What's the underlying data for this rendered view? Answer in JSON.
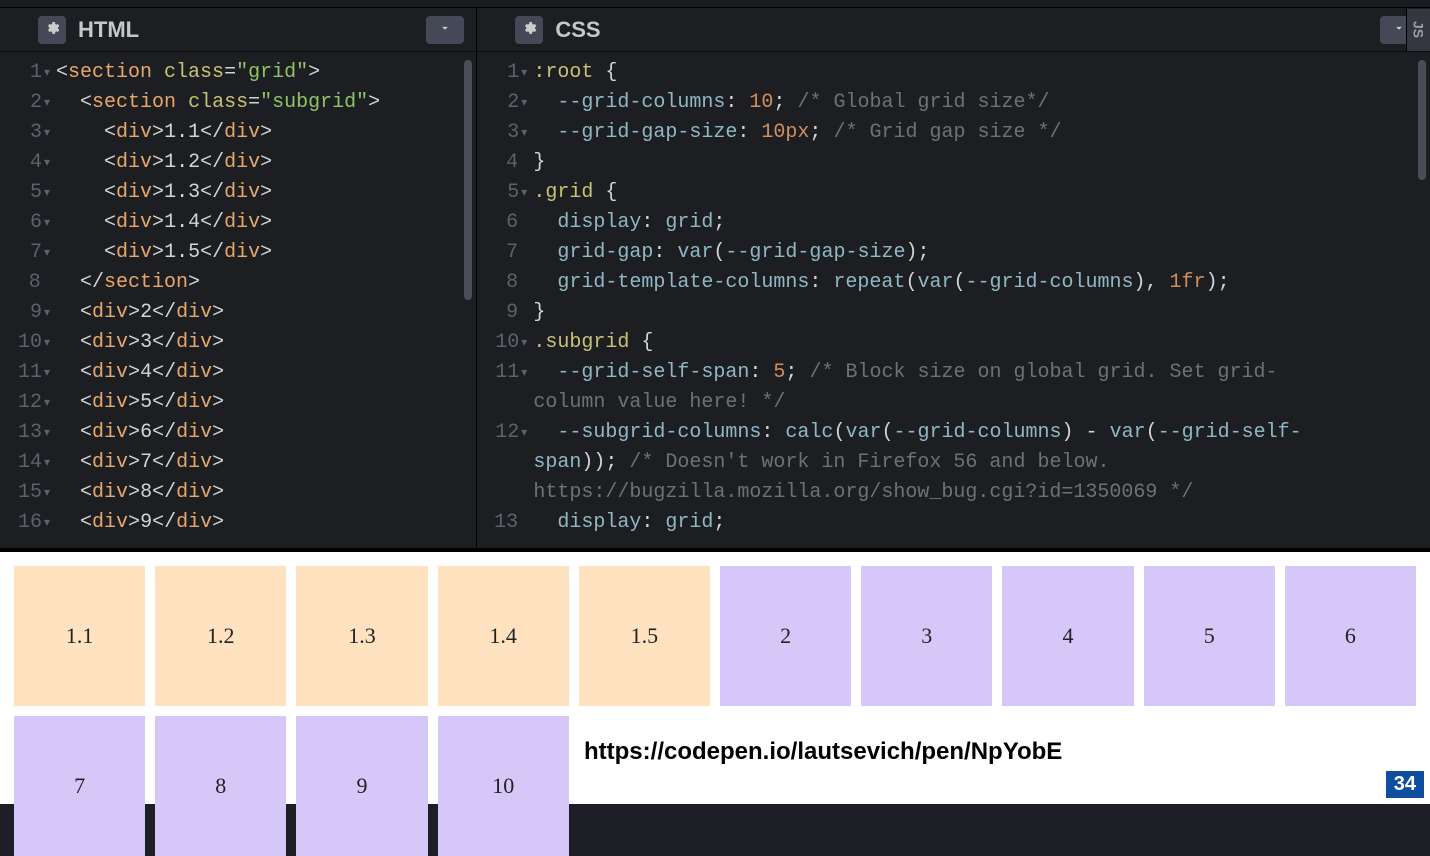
{
  "panes": {
    "html": {
      "title": "HTML"
    },
    "css": {
      "title": "CSS"
    },
    "js": {
      "title": "JS"
    }
  },
  "html_lines": [
    {
      "n": "1",
      "fold": true,
      "html": "<span class='ang'>&lt;</span><span class='tag'>section</span> <span class='attr-name'>class</span><span class='punct'>=</span><span class='str'>\"grid\"</span><span class='ang'>&gt;</span>"
    },
    {
      "n": "2",
      "fold": true,
      "html": "  <span class='ang'>&lt;</span><span class='tag'>section</span> <span class='attr-name'>class</span><span class='punct'>=</span><span class='str'>\"subgrid\"</span><span class='ang'>&gt;</span>"
    },
    {
      "n": "3",
      "fold": true,
      "html": "    <span class='ang'>&lt;</span><span class='tag'>div</span><span class='ang'>&gt;</span>1.1<span class='ang'>&lt;/</span><span class='tag'>div</span><span class='ang'>&gt;</span>"
    },
    {
      "n": "4",
      "fold": true,
      "html": "    <span class='ang'>&lt;</span><span class='tag'>div</span><span class='ang'>&gt;</span>1.2<span class='ang'>&lt;/</span><span class='tag'>div</span><span class='ang'>&gt;</span>"
    },
    {
      "n": "5",
      "fold": true,
      "html": "    <span class='ang'>&lt;</span><span class='tag'>div</span><span class='ang'>&gt;</span>1.3<span class='ang'>&lt;/</span><span class='tag'>div</span><span class='ang'>&gt;</span>"
    },
    {
      "n": "6",
      "fold": true,
      "html": "    <span class='ang'>&lt;</span><span class='tag'>div</span><span class='ang'>&gt;</span>1.4<span class='ang'>&lt;/</span><span class='tag'>div</span><span class='ang'>&gt;</span>"
    },
    {
      "n": "7",
      "fold": true,
      "html": "    <span class='ang'>&lt;</span><span class='tag'>div</span><span class='ang'>&gt;</span>1.5<span class='ang'>&lt;/</span><span class='tag'>div</span><span class='ang'>&gt;</span>"
    },
    {
      "n": "8",
      "fold": false,
      "html": "  <span class='ang'>&lt;/</span><span class='tag'>section</span><span class='ang'>&gt;</span>"
    },
    {
      "n": "9",
      "fold": true,
      "html": "  <span class='ang'>&lt;</span><span class='tag'>div</span><span class='ang'>&gt;</span>2<span class='ang'>&lt;/</span><span class='tag'>div</span><span class='ang'>&gt;</span>"
    },
    {
      "n": "10",
      "fold": true,
      "html": "  <span class='ang'>&lt;</span><span class='tag'>div</span><span class='ang'>&gt;</span>3<span class='ang'>&lt;/</span><span class='tag'>div</span><span class='ang'>&gt;</span>"
    },
    {
      "n": "11",
      "fold": true,
      "html": "  <span class='ang'>&lt;</span><span class='tag'>div</span><span class='ang'>&gt;</span>4<span class='ang'>&lt;/</span><span class='tag'>div</span><span class='ang'>&gt;</span>"
    },
    {
      "n": "12",
      "fold": true,
      "html": "  <span class='ang'>&lt;</span><span class='tag'>div</span><span class='ang'>&gt;</span>5<span class='ang'>&lt;/</span><span class='tag'>div</span><span class='ang'>&gt;</span>"
    },
    {
      "n": "13",
      "fold": true,
      "html": "  <span class='ang'>&lt;</span><span class='tag'>div</span><span class='ang'>&gt;</span>6<span class='ang'>&lt;/</span><span class='tag'>div</span><span class='ang'>&gt;</span>"
    },
    {
      "n": "14",
      "fold": true,
      "html": "  <span class='ang'>&lt;</span><span class='tag'>div</span><span class='ang'>&gt;</span>7<span class='ang'>&lt;/</span><span class='tag'>div</span><span class='ang'>&gt;</span>"
    },
    {
      "n": "15",
      "fold": true,
      "html": "  <span class='ang'>&lt;</span><span class='tag'>div</span><span class='ang'>&gt;</span>8<span class='ang'>&lt;/</span><span class='tag'>div</span><span class='ang'>&gt;</span>"
    },
    {
      "n": "16",
      "fold": true,
      "html": "  <span class='ang'>&lt;</span><span class='tag'>div</span><span class='ang'>&gt;</span>9<span class='ang'>&lt;/</span><span class='tag'>div</span><span class='ang'>&gt;</span>"
    }
  ],
  "css_lines": [
    {
      "n": "1",
      "fold": true,
      "html": "<span class='sel'>:root</span> <span class='punct'>{</span>"
    },
    {
      "n": "2",
      "fold": true,
      "html": "  <span class='prop'>--grid-columns</span><span class='punct'>:</span> <span class='num'>10</span><span class='punct'>;</span> <span class='cmt'>/* Global grid size*/</span>"
    },
    {
      "n": "3",
      "fold": true,
      "html": "  <span class='prop'>--grid-gap-size</span><span class='punct'>:</span> <span class='num'>10px</span><span class='punct'>;</span> <span class='cmt'>/* Grid gap size */</span>"
    },
    {
      "n": "4",
      "fold": false,
      "html": "<span class='punct'>}</span>"
    },
    {
      "n": "5",
      "fold": true,
      "html": "<span class='sel'>.grid</span> <span class='punct'>{</span>"
    },
    {
      "n": "6",
      "fold": false,
      "html": "  <span class='prop'>display</span><span class='punct'>:</span> <span class='val'>grid</span><span class='punct'>;</span>"
    },
    {
      "n": "7",
      "fold": false,
      "html": "  <span class='prop'>grid-gap</span><span class='punct'>:</span> <span class='fn'>var</span><span class='punct'>(</span><span class='val'>--grid-gap-size</span><span class='punct'>);</span>"
    },
    {
      "n": "8",
      "fold": false,
      "html": "  <span class='prop'>grid-template-columns</span><span class='punct'>:</span> <span class='fn'>repeat</span><span class='punct'>(</span><span class='fn'>var</span><span class='punct'>(</span><span class='val'>--grid-columns</span><span class='punct'>),</span> <span class='num'>1fr</span><span class='punct'>);</span>"
    },
    {
      "n": "9",
      "fold": false,
      "html": "<span class='punct'>}</span>"
    },
    {
      "n": "10",
      "fold": true,
      "html": "<span class='sel'>.subgrid</span> <span class='punct'>{</span>"
    },
    {
      "n": "11",
      "fold": true,
      "html": "  <span class='prop'>--grid-self-span</span><span class='punct'>:</span> <span class='num'>5</span><span class='punct'>;</span> <span class='cmt'>/* Block size on global grid. Set grid-</span>"
    },
    {
      "n": "",
      "fold": false,
      "html": "<span class='cmt'>column value here! */</span>"
    },
    {
      "n": "12",
      "fold": true,
      "html": "  <span class='prop'>--subgrid-columns</span><span class='punct'>:</span> <span class='fn'>calc</span><span class='punct'>(</span><span class='fn'>var</span><span class='punct'>(</span><span class='val'>--grid-columns</span><span class='punct'>)</span> <span class='punct'>-</span> <span class='fn'>var</span><span class='punct'>(</span><span class='val'>--grid-self-</span>"
    },
    {
      "n": "",
      "fold": false,
      "html": "<span class='val'>span</span><span class='punct'>));</span> <span class='cmt'>/* Doesn't work in Firefox 56 and below. </span>"
    },
    {
      "n": "",
      "fold": false,
      "html": "<span class='cmt'>https://bugzilla.mozilla.org/show_bug.cgi?id=1350069 */</span>"
    },
    {
      "n": "13",
      "fold": false,
      "html": "  <span class='prop'>display</span><span class='punct'>:</span> <span class='val'>grid</span><span class='punct'>;</span>"
    }
  ],
  "output": {
    "subgrid": [
      "1.1",
      "1.2",
      "1.3",
      "1.4",
      "1.5"
    ],
    "rest_row1": [
      "2",
      "3",
      "4",
      "5",
      "6"
    ],
    "rest_row2": [
      "7",
      "8",
      "9",
      "10"
    ]
  },
  "url": "https://codepen.io/lautsevich/pen/NpYobE",
  "page_number": "34"
}
